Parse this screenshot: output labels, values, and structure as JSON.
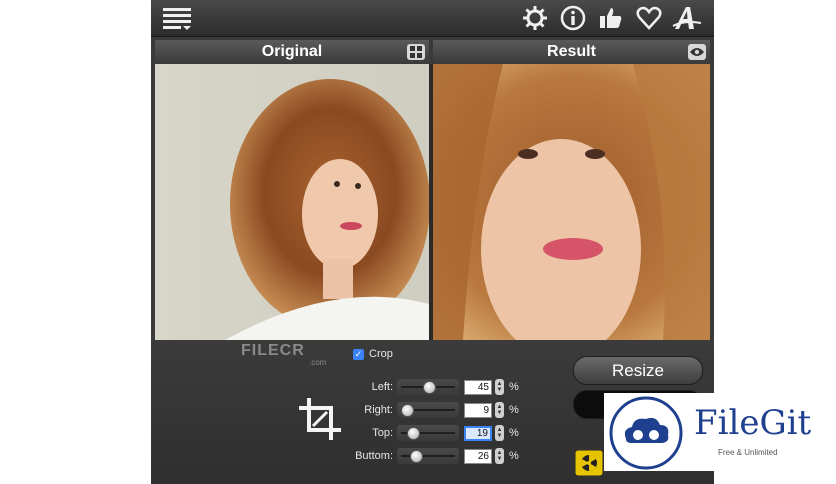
{
  "toolbar": {
    "menu_icon": "menu-lines-icon",
    "icons": [
      "gear-icon",
      "info-icon",
      "thumbs-up-icon",
      "heart-icon",
      "font-a-icon"
    ]
  },
  "panels": {
    "original": {
      "title": "Original",
      "button_icon": "layout-toggle-icon"
    },
    "result": {
      "title": "Result",
      "button_icon": "eye-icon"
    }
  },
  "watermark": {
    "text": "FILECR",
    "sub": ".com"
  },
  "crop": {
    "label": "Crop",
    "checked": true,
    "fields": [
      {
        "label": "Left:",
        "value": "45",
        "unit": "%"
      },
      {
        "label": "Right:",
        "value": "9",
        "unit": "%"
      },
      {
        "label": "Top:",
        "value": "19",
        "unit": "%"
      },
      {
        "label": "Buttom:",
        "value": "26",
        "unit": "%"
      }
    ]
  },
  "actions": {
    "resize_label": "Resize"
  },
  "badge": {
    "title": "FileGit",
    "subtitle": "Free & Unlimited"
  },
  "colors": {
    "accent": "#3b82f6",
    "panel_bg": "#3a3a3a",
    "badge_blue": "#1f3f8f"
  }
}
